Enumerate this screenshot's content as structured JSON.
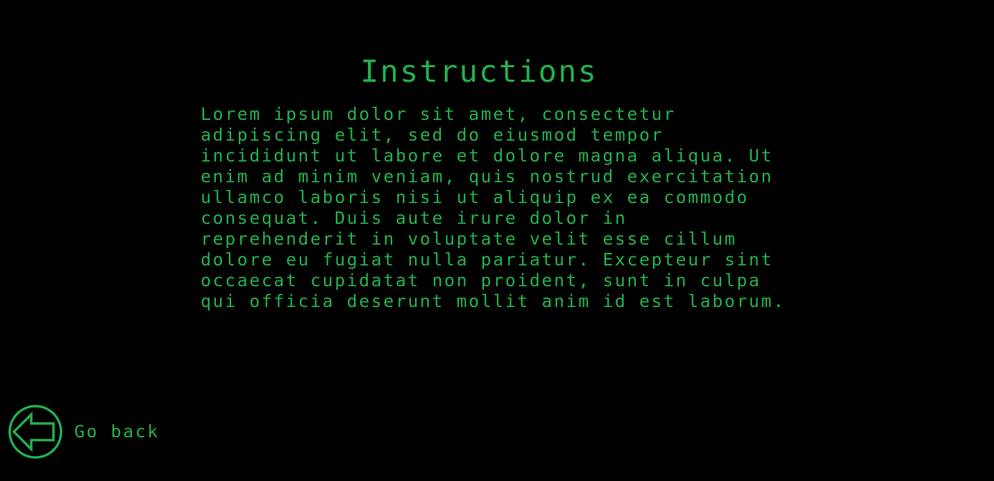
{
  "colors": {
    "background": "#000000",
    "accent": "#22b14c"
  },
  "page": {
    "title": "Instructions",
    "body": "Lorem ipsum dolor sit amet, consectetur\nadipiscing elit, sed do eiusmod tempor\nincididunt ut labore et dolore magna aliqua. Ut\nenim ad minim veniam, quis nostrud exercitation\nullamco laboris nisi ut aliquip ex ea commodo\nconsequat. Duis aute irure dolor in\nreprehenderit in voluptate velit esse cillum\ndolore eu fugiat nulla pariatur. Excepteur sint\noccaecat cupidatat non proident, sunt in culpa\nqui officia deserunt mollit anim id est laborum."
  },
  "back_button": {
    "icon": "arrow-left-circle-icon",
    "label": "Go back"
  }
}
